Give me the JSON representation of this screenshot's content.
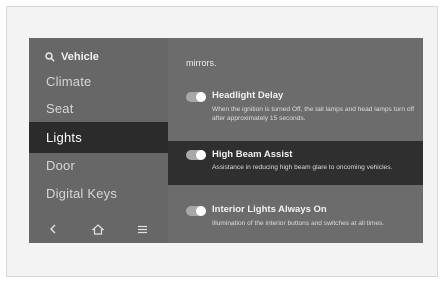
{
  "sidebar": {
    "search_label": "Vehicle",
    "items": [
      {
        "label": "Climate",
        "active": false
      },
      {
        "label": "Seat",
        "active": false
      },
      {
        "label": "Lights",
        "active": true
      },
      {
        "label": "Door",
        "active": false
      },
      {
        "label": "Digital Keys",
        "active": false
      }
    ],
    "bottom_nav": [
      "back-icon",
      "home-icon",
      "menu-icon"
    ]
  },
  "content": {
    "partial_text": "mirrors.",
    "settings": [
      {
        "title": "Headlight Delay",
        "description": "When the ignition is turned Off, the tail lamps and head lamps turn off after approximately 15 seconds.",
        "enabled": true,
        "highlighted": false
      },
      {
        "title": "High Beam Assist",
        "description": "Assistance in reducing high beam glare to oncoming vehicles.",
        "enabled": true,
        "highlighted": true
      },
      {
        "title": "Interior Lights Always On",
        "description": "Illumination of the interior buttons and switches at all times.",
        "enabled": true,
        "highlighted": false
      }
    ]
  },
  "colors": {
    "screen_bg": "#6c6c6c",
    "active_bg": "#2b2b2b",
    "toggle_on": "#a8a8a8"
  }
}
